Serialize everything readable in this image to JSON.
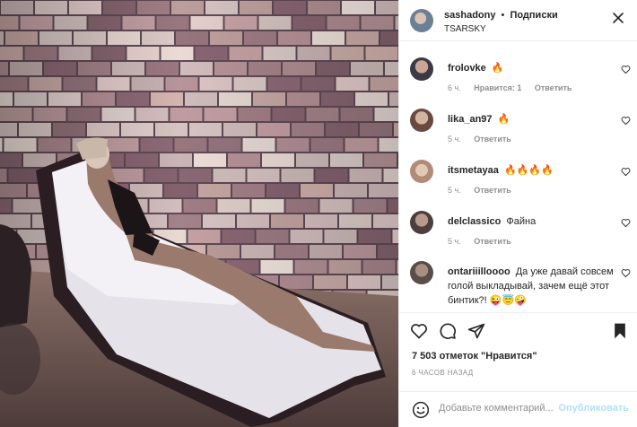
{
  "colors": {
    "text": "#262626",
    "meta": "#8e8e8e",
    "post_disabled": "#b2dffc",
    "border": "#efefef"
  },
  "photo": {
    "icon": "beach-lounger-photo"
  },
  "header": {
    "username": "sashadony",
    "dot": "•",
    "follow_label": "Подписки",
    "location": "TSARSKY",
    "more_icon": "more-horizontal-icon"
  },
  "comments": [
    {
      "username": "frolovke",
      "text": "🔥",
      "time": "6 ч.",
      "likes": "Нравится: 1",
      "reply": "Ответить"
    },
    {
      "username": "lika_an97",
      "text": "🔥",
      "time": "5 ч.",
      "reply": "Ответить"
    },
    {
      "username": "itsmetayaa",
      "text": "🔥🔥🔥🔥",
      "time": "5 ч.",
      "reply": "Ответить"
    },
    {
      "username": "delclassico",
      "text": "Файна",
      "time": "5 ч.",
      "reply": "Ответить"
    },
    {
      "username": "ontariiilloooo",
      "text": "Да уже давай совсем голой выкладывай, зачем ещё этот бинтик?! 😜😇🤪"
    }
  ],
  "actions": {
    "like_icon": "heart-icon",
    "comment_icon": "comment-icon",
    "share_icon": "paper-plane-icon",
    "save_icon": "bookmark-icon"
  },
  "likes_text": "7 503 отметок \"Нравится\"",
  "time_ago": "6 ЧАСОВ НАЗАД",
  "add_comment": {
    "placeholder": "Добавьте комментарий...",
    "post_label": "Опубликовать",
    "emoji_icon": "emoji-icon"
  }
}
